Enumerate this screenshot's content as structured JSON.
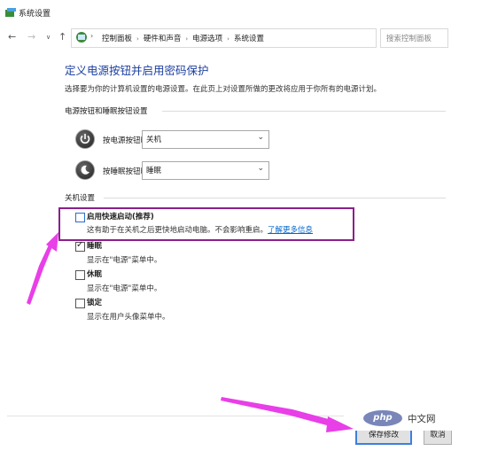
{
  "window": {
    "title": "系统设置"
  },
  "address": {
    "crumbs": [
      "控制面板",
      "硬件和声音",
      "电源选项",
      "系统设置"
    ],
    "search_placeholder": "搜索控制面板"
  },
  "page": {
    "heading": "定义电源按钮并启用密码保护",
    "description": "选择要为你的计算机设置的电源设置。在此页上对设置所做的更改将应用于你所有的电源计划。"
  },
  "power_section": {
    "title": "电源按钮和睡眠按钮设置",
    "rows": [
      {
        "label": "按电源按钮时:",
        "value": "关机"
      },
      {
        "label": "按睡眠按钮时:",
        "value": "睡眠"
      }
    ]
  },
  "shutdown_section": {
    "title": "关机设置",
    "options": [
      {
        "title": "启用快速启动(推荐)",
        "desc": "这有助于在关机之后更快地启动电脑。不会影响重启。",
        "link": "了解更多信息",
        "checked": false
      },
      {
        "title": "睡眠",
        "desc": "显示在\"电源\"菜单中。",
        "checked": true
      },
      {
        "title": "休眠",
        "desc": "显示在\"电源\"菜单中。",
        "checked": false
      },
      {
        "title": "锁定",
        "desc": "显示在用户头像菜单中。",
        "checked": false
      }
    ]
  },
  "buttons": {
    "save": "保存修改",
    "cancel": "取消"
  },
  "watermark": {
    "logo": "php",
    "text": "中文网"
  },
  "colors": {
    "heading": "#1c3fa0",
    "highlight": "#8b1f8b",
    "arrow": "#e83fe8",
    "link": "#0066cc"
  }
}
